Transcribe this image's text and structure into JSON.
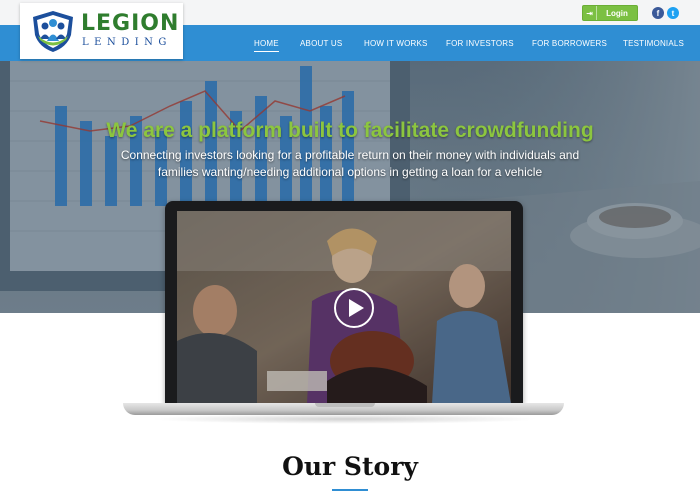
{
  "logo": {
    "name_top": "LEGION",
    "name_bottom": "LENDING"
  },
  "topbar": {
    "login_label": "Login",
    "login_icon": "sign-in-icon",
    "social": [
      {
        "name": "facebook-icon",
        "glyph": "f"
      },
      {
        "name": "twitter-icon",
        "glyph": "t"
      }
    ]
  },
  "nav": {
    "items": [
      {
        "label": "HOME",
        "active": true
      },
      {
        "label": "ABOUT US"
      },
      {
        "label": "HOW IT WORKS"
      },
      {
        "label": "FOR INVESTORS"
      },
      {
        "label": "FOR BORROWERS"
      },
      {
        "label": "TESTIMONIALS"
      }
    ]
  },
  "hero": {
    "title": "We are a platform built to facilitate crowdfunding",
    "subtitle_line1": "Connecting investors looking for a profitable return on their money with individuals and",
    "subtitle_line2": "families wanting/needing additional options in getting a loan for a vehicle"
  },
  "video": {
    "play_icon": "play-icon"
  },
  "story": {
    "title": "Our Story"
  },
  "colors": {
    "nav_blue": "#2f8ed3",
    "brand_green": "#8cc63f",
    "login_green": "#7bc043",
    "logo_green": "#2f7d2e",
    "logo_blue": "#1c4f9c"
  }
}
